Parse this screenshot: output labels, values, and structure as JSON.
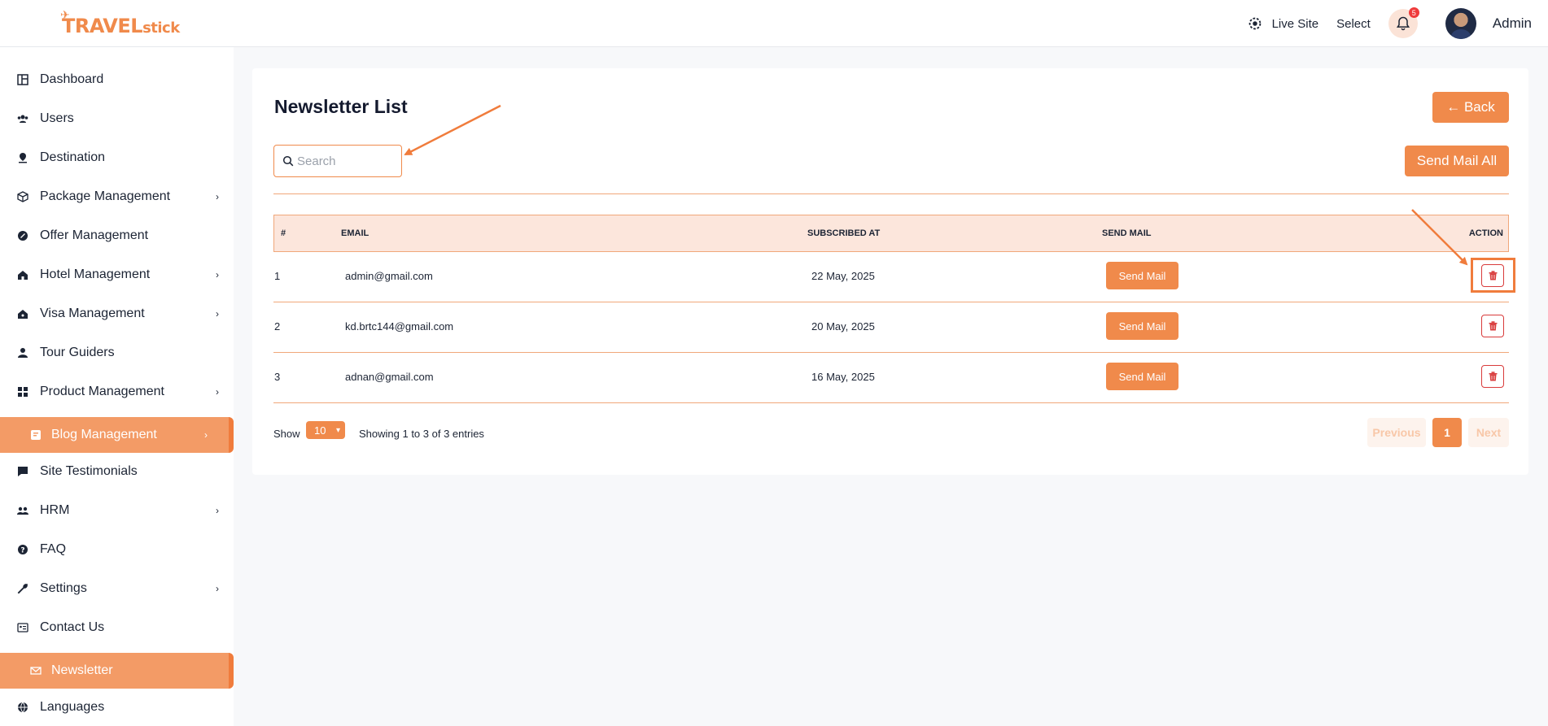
{
  "header": {
    "brand_main": "TRAVEL",
    "brand_sub": "stick",
    "live_site": "Live Site",
    "select": "Select",
    "notification_count": "5",
    "user_name": "Admin"
  },
  "sidebar": {
    "items": [
      {
        "label": "Dashboard",
        "icon": "dashboard-icon",
        "chevron": false,
        "active": false
      },
      {
        "label": "Users",
        "icon": "users-icon",
        "chevron": false,
        "active": false
      },
      {
        "label": "Destination",
        "icon": "location-pin-icon",
        "chevron": false,
        "active": false
      },
      {
        "label": "Package Management",
        "icon": "package-icon",
        "chevron": true,
        "active": false
      },
      {
        "label": "Offer Management",
        "icon": "offer-icon",
        "chevron": false,
        "active": false
      },
      {
        "label": "Hotel Management",
        "icon": "hotel-icon",
        "chevron": true,
        "active": false
      },
      {
        "label": "Visa Management",
        "icon": "visa-icon",
        "chevron": true,
        "active": false
      },
      {
        "label": "Tour Guiders",
        "icon": "guide-icon",
        "chevron": false,
        "active": false
      },
      {
        "label": "Product Management",
        "icon": "grid-icon",
        "chevron": true,
        "active": false
      },
      {
        "label": "Blog Management",
        "icon": "blog-icon",
        "chevron": true,
        "active": true
      },
      {
        "label": "Site Testimonials",
        "icon": "comment-icon",
        "chevron": false,
        "active": false
      },
      {
        "label": "HRM",
        "icon": "team-icon",
        "chevron": true,
        "active": false
      },
      {
        "label": "FAQ",
        "icon": "question-icon",
        "chevron": false,
        "active": false
      },
      {
        "label": "Settings",
        "icon": "wrench-icon",
        "chevron": true,
        "active": false
      },
      {
        "label": "Contact Us",
        "icon": "contact-card-icon",
        "chevron": false,
        "active": false
      },
      {
        "label": "Newsletter",
        "icon": "mail-icon",
        "chevron": false,
        "active": true
      },
      {
        "label": "Languages",
        "icon": "globe-icon",
        "chevron": false,
        "active": false
      }
    ]
  },
  "main": {
    "title": "Newsletter List",
    "back_label": "← Back",
    "send_all_label": "Send Mail All",
    "search_placeholder": "Search",
    "columns": {
      "num": "#",
      "email": "EMAIL",
      "subscribed": "SUBSCRIBED AT",
      "send": "SEND MAIL",
      "action": "ACTION"
    },
    "rows": [
      {
        "num": "1",
        "email": "admin@gmail.com",
        "subscribed": "22 May, 2025",
        "send": "Send Mail"
      },
      {
        "num": "2",
        "email": "kd.brtc144@gmail.com",
        "subscribed": "20 May, 2025",
        "send": "Send Mail"
      },
      {
        "num": "3",
        "email": "adnan@gmail.com",
        "subscribed": "16 May, 2025",
        "send": "Send Mail"
      }
    ],
    "footer": {
      "show_label": "Show",
      "page_size": "10",
      "info": "Showing 1 to 3 of 3 entries",
      "prev": "Previous",
      "current_page": "1",
      "next": "Next"
    }
  },
  "colors": {
    "accent": "#f08a4b",
    "header_bg": "#fce6dc",
    "danger": "#d93b3b",
    "annotation": "#f07c3c"
  }
}
